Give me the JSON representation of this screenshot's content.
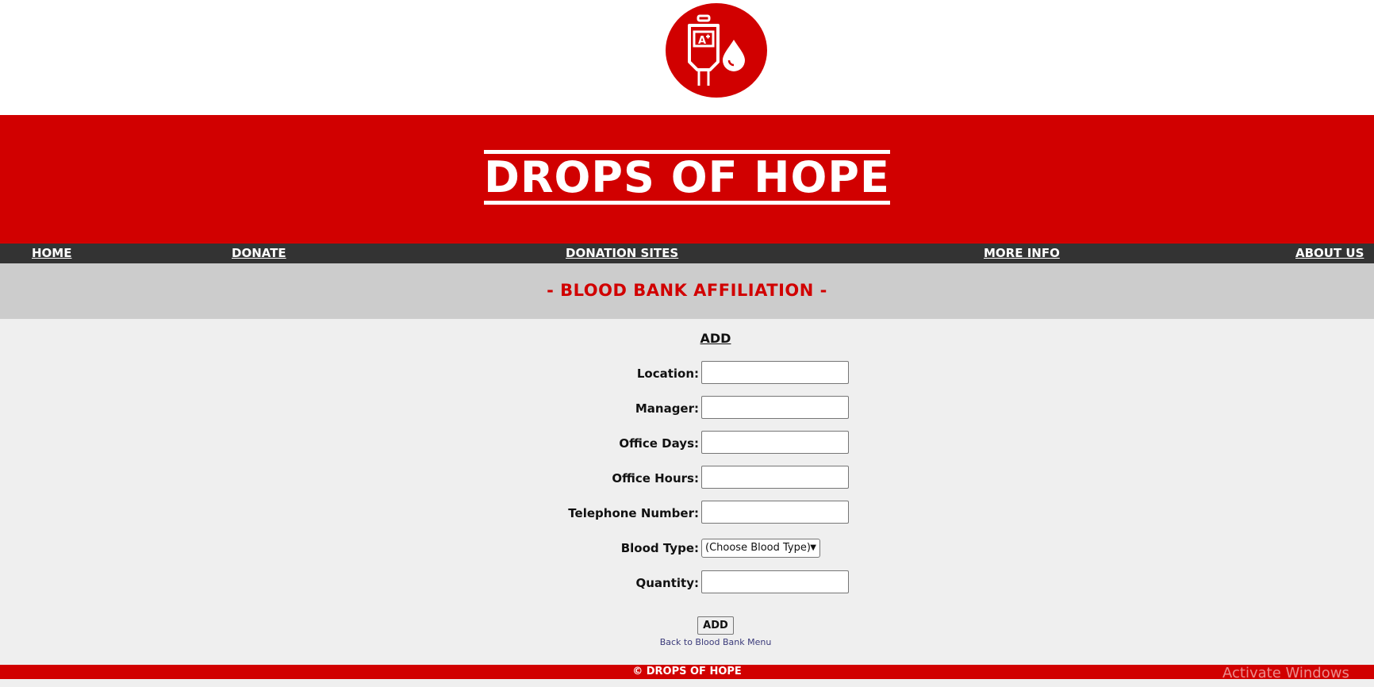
{
  "brand": {
    "logo_icon": "blood-bag-icon",
    "title": "DROPS OF HOPE",
    "accent_color": "#d10000"
  },
  "nav": {
    "items": [
      {
        "label": "HOME"
      },
      {
        "label": "DONATE"
      },
      {
        "label": "DONATION SITES"
      },
      {
        "label": "MORE INFO"
      },
      {
        "label": "ABOUT US"
      }
    ]
  },
  "section": {
    "title": "- BLOOD BANK AFFILIATION -"
  },
  "form": {
    "heading": "ADD",
    "fields": [
      {
        "label": "Location:",
        "value": ""
      },
      {
        "label": "Manager:",
        "value": ""
      },
      {
        "label": "Office Days:",
        "value": ""
      },
      {
        "label": "Office Hours:",
        "value": ""
      },
      {
        "label": "Telephone Number:",
        "value": ""
      },
      {
        "label": "Blood Type:",
        "selected": "(Choose Blood Type)"
      },
      {
        "label": "Quantity:",
        "value": ""
      }
    ],
    "submit_label": "ADD",
    "back_link": "Back to Blood Bank Menu"
  },
  "footer": {
    "text": "© DROPS OF HOPE"
  },
  "watermark": "Activate Windows"
}
